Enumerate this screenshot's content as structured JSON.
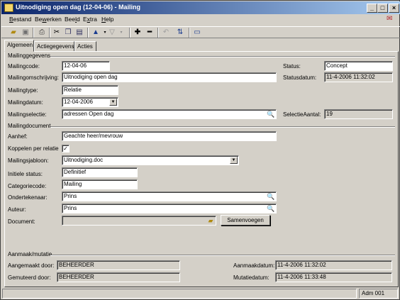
{
  "window": {
    "title": "Uitnodiging open dag  (12-04-06) - Mailing",
    "controls": {
      "minimize": "_",
      "maximize": "□",
      "close": "×"
    }
  },
  "menu": [
    "Bestand",
    "Bewerken",
    "Beeld",
    "Extra",
    "Help"
  ],
  "menu_underline": [
    "B",
    "w",
    "l",
    "x",
    "H"
  ],
  "toolbar": {
    "icons": [
      "open-folder-icon",
      "save-icon",
      "print-icon",
      "cut-icon",
      "copy-icon",
      "paste-icon",
      "up-arrow-icon",
      "down-arrow-icon",
      "add-icon",
      "remove-icon",
      "undo-icon",
      "refresh-icon",
      "window-icon"
    ]
  },
  "tabs": [
    "Algemeen",
    "Actiegegevens",
    "Acties"
  ],
  "mailinggegevens": {
    "section_title": "Mailinggegevens",
    "mailingcode_label": "Mailingcode:",
    "mailingcode_value": "12-04-06",
    "omschrijving_label": "Mailingomschrijving:",
    "omschrijving_value": "Uitnodiging open dag",
    "type_label": "Mailingtype:",
    "type_value": "Relatie",
    "datum_label": "Mailingdatum:",
    "datum_value": "12-04-2006",
    "selectie_label": "Mailingselectie:",
    "selectie_value": "adressen Open dag",
    "status_label": "Status:",
    "status_value": "Concept",
    "statusdatum_label": "Statusdatum:",
    "statusdatum_value": "11-4-2006 11:32:02",
    "selectieaantal_label": "SelectieAantal:",
    "selectieaantal_value": "19"
  },
  "mailingdocument": {
    "section_title": "Mailingdocument",
    "aanhef_label": "Aanhef:",
    "aanhef_value": "Geachte heer/mevrouw",
    "koppelen_label": "Koppelen per relatie",
    "koppelen_checked": "✓",
    "jabloon_label": "Mailingsjabloon:",
    "jabloon_value": "Uitnodiging.doc",
    "initiele_label": "Initiele status:",
    "initiele_value": "Definitief",
    "categorie_label": "Categoriecode:",
    "categorie_value": "Mailing",
    "ondertekenaar_label": "Ondertekenaar:",
    "ondertekenaar_value": "Prins",
    "auteur_label": "Auteur:",
    "auteur_value": "Prins",
    "document_label": "Document:",
    "document_value": "",
    "samenvoegen_label": "Samenvoegen"
  },
  "aanmaak": {
    "section_title": "Aanmaak/mutatie",
    "aangemaakt_label": "Aangemaakt door:",
    "aangemaakt_value": "BEHEERDER",
    "gemuteerd_label": "Gemuteerd door:",
    "gemuteerd_value": "BEHEERDER",
    "aanmaakdatum_label": "Aanmaakdatum:",
    "aanmaakdatum_value": "11-4-2006 11:32:02",
    "mutatiedatum_label": "Mutatiedatum:",
    "mutatiedatum_value": "11-4-2006 11:33:48"
  },
  "statusbar": {
    "user": "Adm 001"
  }
}
